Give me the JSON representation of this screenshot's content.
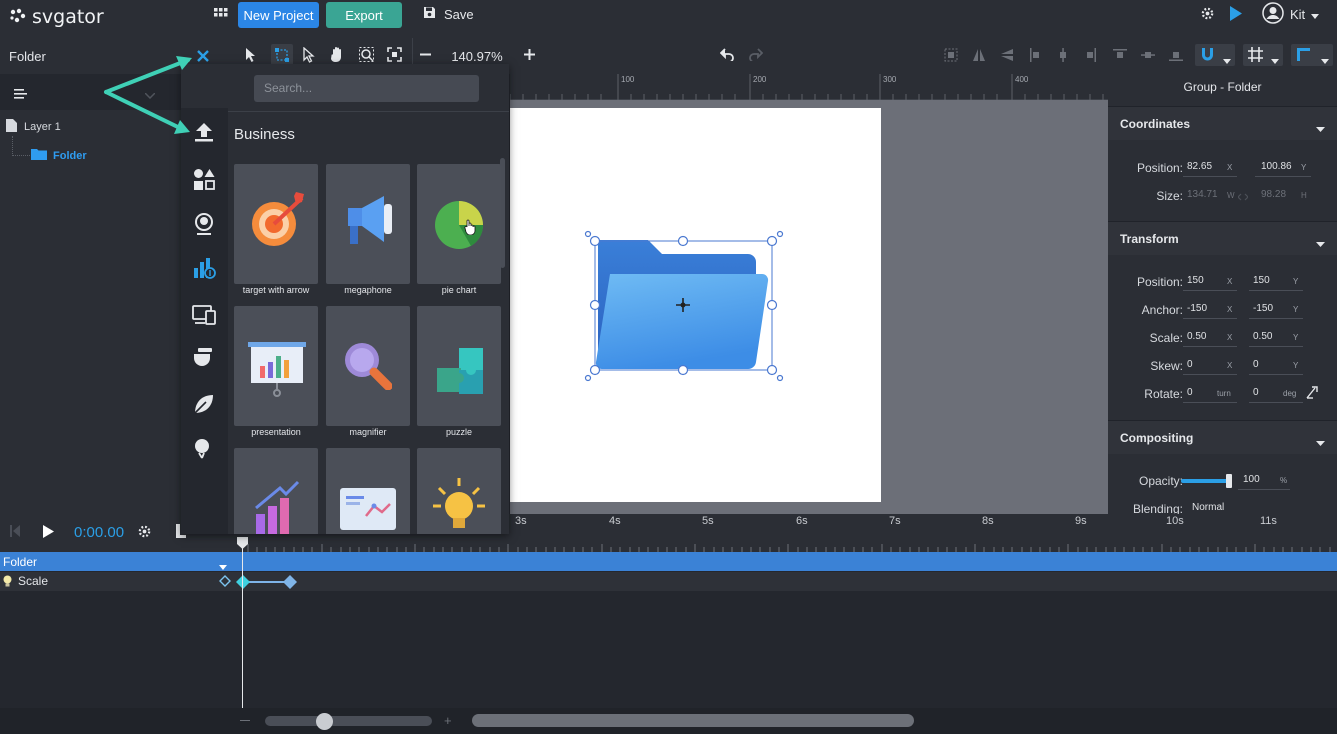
{
  "app": {
    "logo_text": "svgator",
    "new_project_label": "New Project",
    "export_label": "Export",
    "save_label": "Save",
    "user_name": "Kit"
  },
  "toolbar": {
    "zoom_value": "140.97%"
  },
  "left_panel": {
    "title": "Folder",
    "layers": [
      {
        "label": "Layer 1"
      },
      {
        "label": "Folder"
      }
    ]
  },
  "assets": {
    "search_placeholder": "Search...",
    "category": "Business",
    "items": [
      {
        "label": "target with arrow"
      },
      {
        "label": "megaphone"
      },
      {
        "label": "pie chart"
      },
      {
        "label": "presentation"
      },
      {
        "label": "magnifier"
      },
      {
        "label": "puzzle"
      }
    ]
  },
  "ruler": {
    "ticks": [
      "100",
      "200",
      "300",
      "400"
    ]
  },
  "right_panel": {
    "title": "Group - Folder",
    "coordinates": {
      "heading": "Coordinates",
      "position_label": "Position:",
      "position_x": "82.65",
      "position_y": "100.86",
      "size_label": "Size:",
      "size_w": "134.71",
      "size_h": "98.28",
      "x_unit": "X",
      "y_unit": "Y",
      "w_unit": "W",
      "h_unit": "H"
    },
    "transform": {
      "heading": "Transform",
      "position_label": "Position:",
      "position_x": "150",
      "position_y": "150",
      "anchor_label": "Anchor:",
      "anchor_x": "-150",
      "anchor_y": "-150",
      "scale_label": "Scale:",
      "scale_x": "0.50",
      "scale_y": "0.50",
      "skew_label": "Skew:",
      "skew_x": "0",
      "skew_y": "0",
      "rotate_label": "Rotate:",
      "rotate_turn": "0",
      "rotate_deg": "0",
      "turn_unit": "turn",
      "deg_unit": "deg"
    },
    "compositing": {
      "heading": "Compositing",
      "opacity_label": "Opacity:",
      "opacity_value": "100",
      "opacity_unit": "%",
      "opacity_fraction": 1.0,
      "blending_label": "Blending:",
      "blending_value": "Normal"
    }
  },
  "timeline": {
    "time": "0:00.00",
    "seconds": [
      "3s",
      "4s",
      "5s",
      "6s",
      "7s",
      "8s",
      "9s",
      "10s",
      "11s"
    ],
    "tracks": [
      {
        "label": "Folder"
      },
      {
        "label": "Scale"
      }
    ]
  },
  "colors": {
    "accent_blue": "#2b86e6",
    "export_green": "#3aa594",
    "teal_arrow": "#3fd0b6",
    "folder_track": "#3b82d6"
  }
}
